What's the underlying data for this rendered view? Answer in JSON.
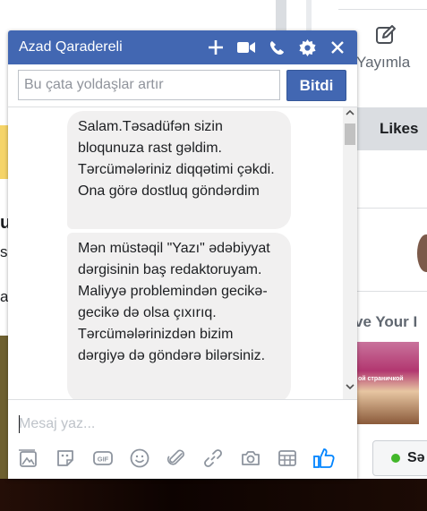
{
  "chat": {
    "title": "Azad Qaradereli",
    "add_placeholder": "Bu çata yoldaşlar artır",
    "done_label": "Bitdi",
    "messages": [
      "Salam.Təsadüfən sizin bloqunuza rast gəldim. Tərcümələriniz diqqətimi çəkdi. Ona görə dostluq göndərdim",
      "Mən müstəqil \"Yazı\" ədəbiyyat dərgisinin baş redaktoruyam. Maliyyə problemindən gecikə-gecikə də olsa çıxırıq. Tərcümələrinizdən bizim dərgiyə də göndərə bilərsiniz."
    ],
    "composer_placeholder": "Mesaj yaz...",
    "header_icons": [
      "plus-icon",
      "video-camera-icon",
      "phone-icon",
      "gear-icon",
      "close-icon"
    ],
    "toolbar_icons": [
      "photo-icon",
      "sticker-icon",
      "gif-icon",
      "emoji-icon",
      "attachment-icon",
      "link-icon",
      "camera-icon",
      "table-icon",
      "thumbs-up-icon"
    ],
    "accent_color": "#4267b2"
  },
  "background": {
    "publish_label": "Yayımla",
    "likes_label": "Likes",
    "love_heading": "ve Your I",
    "book_title": "ой страничкой",
    "status_label": "Sə",
    "left_fragments": [
      "u",
      "s",
      "a"
    ]
  }
}
